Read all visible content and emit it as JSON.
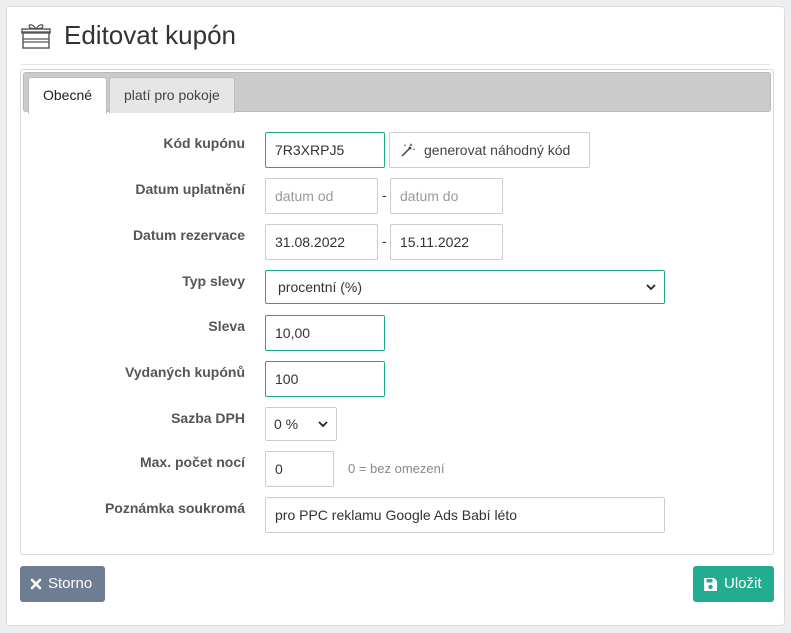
{
  "header": {
    "title": "Editovat kupón",
    "icon": "gift-icon"
  },
  "tabs": [
    {
      "label": "Obecné",
      "active": true
    },
    {
      "label": "platí pro pokoje",
      "active": false
    }
  ],
  "form": {
    "kod": {
      "label": "Kód kupónu",
      "value": "7R3XRPJ5",
      "generate_button": "generovat náhodný kód"
    },
    "datum_uplatneni": {
      "label": "Datum uplatnění",
      "from_placeholder": "datum od",
      "to_placeholder": "datum do",
      "separator": "-"
    },
    "datum_rezervace": {
      "label": "Datum rezervace",
      "from_value": "31.08.2022",
      "to_value": "15.11.2022",
      "separator": "-"
    },
    "typ_slevy": {
      "label": "Typ slevy",
      "value": "procentní (%)"
    },
    "sleva": {
      "label": "Sleva",
      "value": "10,00"
    },
    "vydanych": {
      "label": "Vydaných kupónů",
      "value": "100"
    },
    "sazba_dph": {
      "label": "Sazba DPH",
      "value": "0 %"
    },
    "max_noci": {
      "label": "Max. počet nocí",
      "value": "0",
      "hint": "0 = bez omezení"
    },
    "poznamka": {
      "label": "Poznámka soukromá",
      "value": "pro PPC reklamu Google Ads Babí léto"
    }
  },
  "footer": {
    "cancel_label": "Storno",
    "save_label": "Uložit"
  },
  "colors": {
    "accent": "#1fa889",
    "cancel": "#6d7d92",
    "save": "#21ad8e"
  }
}
